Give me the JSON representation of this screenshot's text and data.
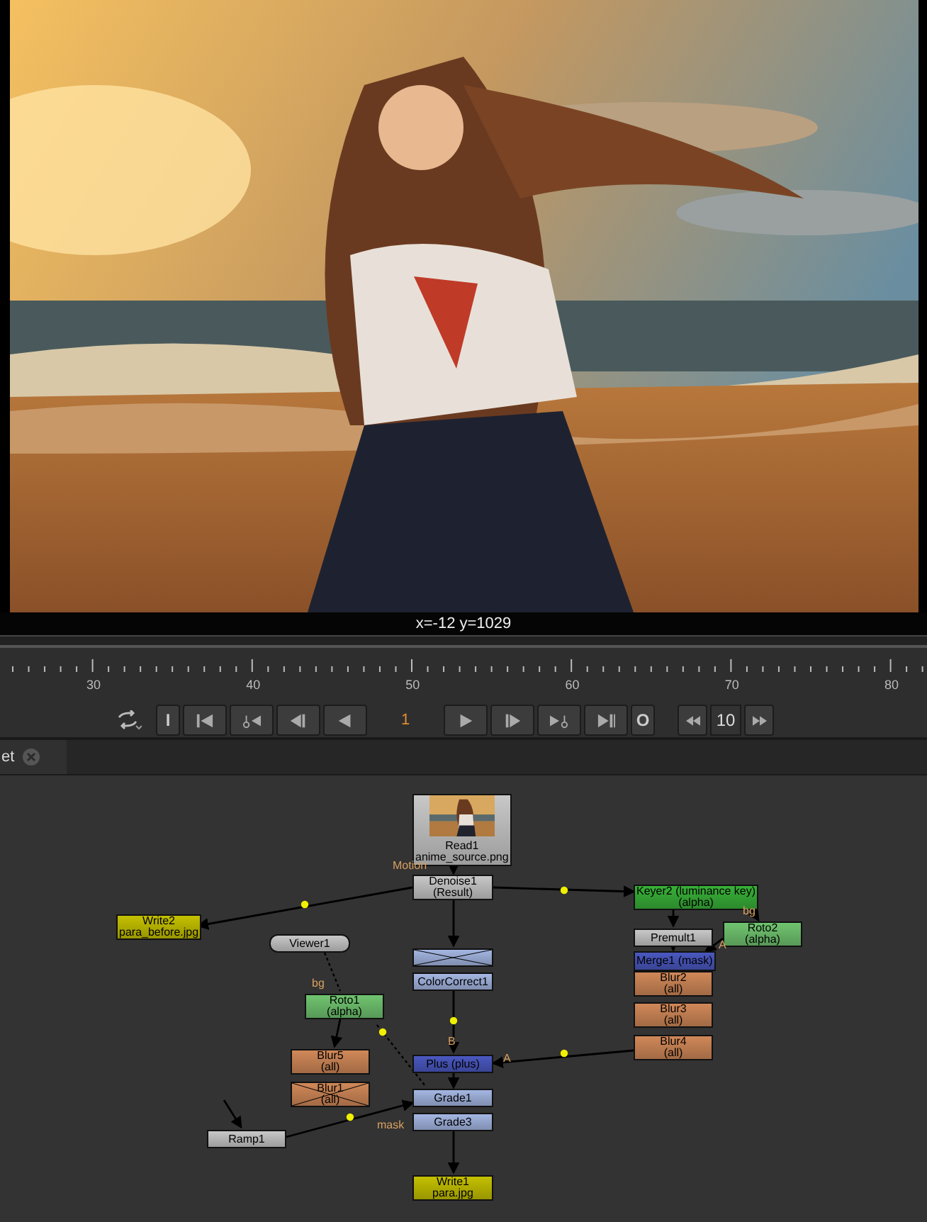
{
  "viewer": {
    "info": "x=-12 y=1029"
  },
  "timeline": {
    "ruler_labels": [
      "30",
      "40",
      "50",
      "60",
      "70",
      "80"
    ]
  },
  "transport": [
    {
      "kind": "loop"
    },
    {
      "kind": "text",
      "label": "I"
    },
    {
      "kind": "first"
    },
    {
      "kind": "prev_key"
    },
    {
      "kind": "step_back"
    },
    {
      "kind": "play_back"
    },
    {
      "kind": "frame",
      "label": "1"
    },
    {
      "kind": "play"
    },
    {
      "kind": "step_forward"
    },
    {
      "kind": "next_key"
    },
    {
      "kind": "last"
    },
    {
      "kind": "text",
      "label": "O"
    }
  ],
  "increment": [
    {
      "kind": "rewind"
    },
    {
      "kind": "field",
      "label": "10"
    },
    {
      "kind": "forward"
    }
  ],
  "tab": {
    "label": "et"
  },
  "nodes": [
    {
      "kind": "read",
      "title": "Read1",
      "sub": "anime_source.png",
      "color": "#c8c8c8",
      "disabled": false
    },
    {
      "kind": "node",
      "title": "Denoise1",
      "sub": "(Result)",
      "color": "#c8c8c8",
      "disabled": false
    },
    {
      "kind": "node",
      "title": "Write2",
      "sub": "para_before.jpg",
      "color": "#c4c000",
      "disabled": false
    },
    {
      "kind": "viewer",
      "title": "Viewer1",
      "color": "#c8c8c8",
      "disabled": false
    },
    {
      "kind": "node",
      "title": "Keyer2 (luminance key)",
      "sub": "(alpha)",
      "color": "#38b038",
      "disabled": false
    },
    {
      "kind": "node",
      "title": "Premult1",
      "color": "#c8c8c8",
      "disabled": false
    },
    {
      "kind": "node",
      "title": "Roto2",
      "sub": "(alpha)",
      "color": "#70c470",
      "disabled": false
    },
    {
      "kind": "node",
      "title": "Merge1 (mask)",
      "color": "#4a58c0",
      "disabled": false
    },
    {
      "kind": "node",
      "title": "Blur2",
      "sub": "(all)",
      "color": "#d08858",
      "disabled": false
    },
    {
      "kind": "node",
      "title": "Blur3",
      "sub": "(all)",
      "color": "#d08858",
      "disabled": false
    },
    {
      "kind": "node",
      "title": "Blur4",
      "sub": "(all)",
      "color": "#d08858",
      "disabled": false
    },
    {
      "kind": "node",
      "color": "#a4b6e2",
      "disabled": true
    },
    {
      "kind": "node",
      "title": "ColorCorrect1",
      "color": "#a4b6e2",
      "disabled": false
    },
    {
      "kind": "node",
      "title": "Roto1",
      "sub": "(alpha)",
      "color": "#70c470",
      "disabled": false
    },
    {
      "kind": "node",
      "title": "Blur5",
      "sub": "(all)",
      "color": "#d08858",
      "disabled": false
    },
    {
      "kind": "node",
      "title": "Blur1",
      "sub": "(all)",
      "color": "#d08858",
      "disabled": true
    },
    {
      "kind": "node",
      "title": "Plus (plus)",
      "color": "#4a58c0",
      "disabled": false
    },
    {
      "kind": "node",
      "title": "Grade1",
      "color": "#a4b6e2",
      "disabled": false
    },
    {
      "kind": "node",
      "title": "Grade3",
      "color": "#a4b6e2",
      "disabled": false
    },
    {
      "kind": "node",
      "title": "Ramp1",
      "color": "#c8c8c8",
      "disabled": false
    },
    {
      "kind": "node",
      "title": "Write1",
      "sub": "para.jpg",
      "color": "#c4c000",
      "disabled": false
    }
  ],
  "edge_labels": [
    {
      "text": "Motion"
    },
    {
      "text": "bg"
    },
    {
      "text": "bg"
    },
    {
      "text": "B"
    },
    {
      "text": "A"
    },
    {
      "text": "A"
    },
    {
      "text": "mask"
    }
  ]
}
